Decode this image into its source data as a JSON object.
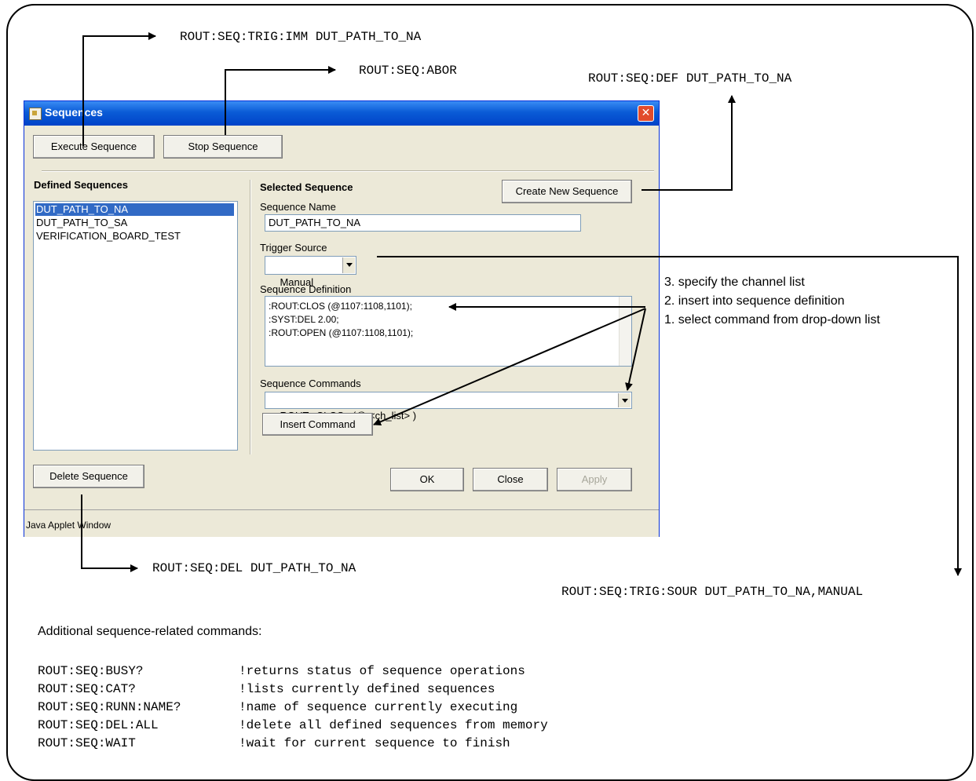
{
  "annotations": {
    "trig_imm": "ROUT:SEQ:TRIG:IMM DUT_PATH_TO_NA",
    "abort": "ROUT:SEQ:ABOR",
    "define": "ROUT:SEQ:DEF DUT_PATH_TO_NA",
    "delete": "ROUT:SEQ:DEL DUT_PATH_TO_NA",
    "trig_source": "ROUT:SEQ:TRIG:SOUR DUT_PATH_TO_NA,MANUAL",
    "step3": "3. specify the channel list",
    "step2": "2. insert into sequence definition",
    "step1": "1. select command from drop-down list"
  },
  "dialog": {
    "title": "Sequences",
    "execute_button": "Execute Sequence",
    "stop_button": "Stop Sequence",
    "defined_sequences_label": "Defined Sequences",
    "sequences": [
      "DUT_PATH_TO_NA",
      "DUT_PATH_TO_SA",
      "VERIFICATION_BOARD_TEST"
    ],
    "selected_index": 0,
    "selected_sequence_label": "Selected Sequence",
    "create_button": "Create New Sequence",
    "sequence_name_label": "Sequence Name",
    "sequence_name_value": "DUT_PATH_TO_NA",
    "trigger_source_label": "Trigger Source",
    "trigger_source_value": "Manual",
    "sequence_definition_label": "Sequence Definition",
    "definition_lines": [
      ":ROUT:CLOS (@1107:1108,1101);",
      ":SYST:DEL 2.00;",
      ":ROUT:OPEN (@1107:1108,1101);"
    ],
    "sequence_commands_label": "Sequence Commands",
    "sequence_commands_value": "ROUTe:CLOSe (@ <ch_list> )",
    "insert_button": "Insert Command",
    "delete_button": "Delete Sequence",
    "ok_button": "OK",
    "close_button": "Close",
    "apply_button": "Apply",
    "status": "Java Applet Window",
    "close_icon": "close-icon"
  },
  "additional": {
    "heading": "Additional sequence-related commands:",
    "commands": [
      {
        "cmd": "ROUT:SEQ:BUSY?",
        "desc": "!returns status of sequence operations"
      },
      {
        "cmd": "ROUT:SEQ:CAT?",
        "desc": "!lists currently defined sequences"
      },
      {
        "cmd": "ROUT:SEQ:RUNN:NAME?",
        "desc": "!name of sequence currently executing"
      },
      {
        "cmd": "ROUT:SEQ:DEL:ALL",
        "desc": "!delete all defined sequences from memory"
      },
      {
        "cmd": "ROUT:SEQ:WAIT",
        "desc": "!wait for current sequence to finish"
      }
    ]
  }
}
